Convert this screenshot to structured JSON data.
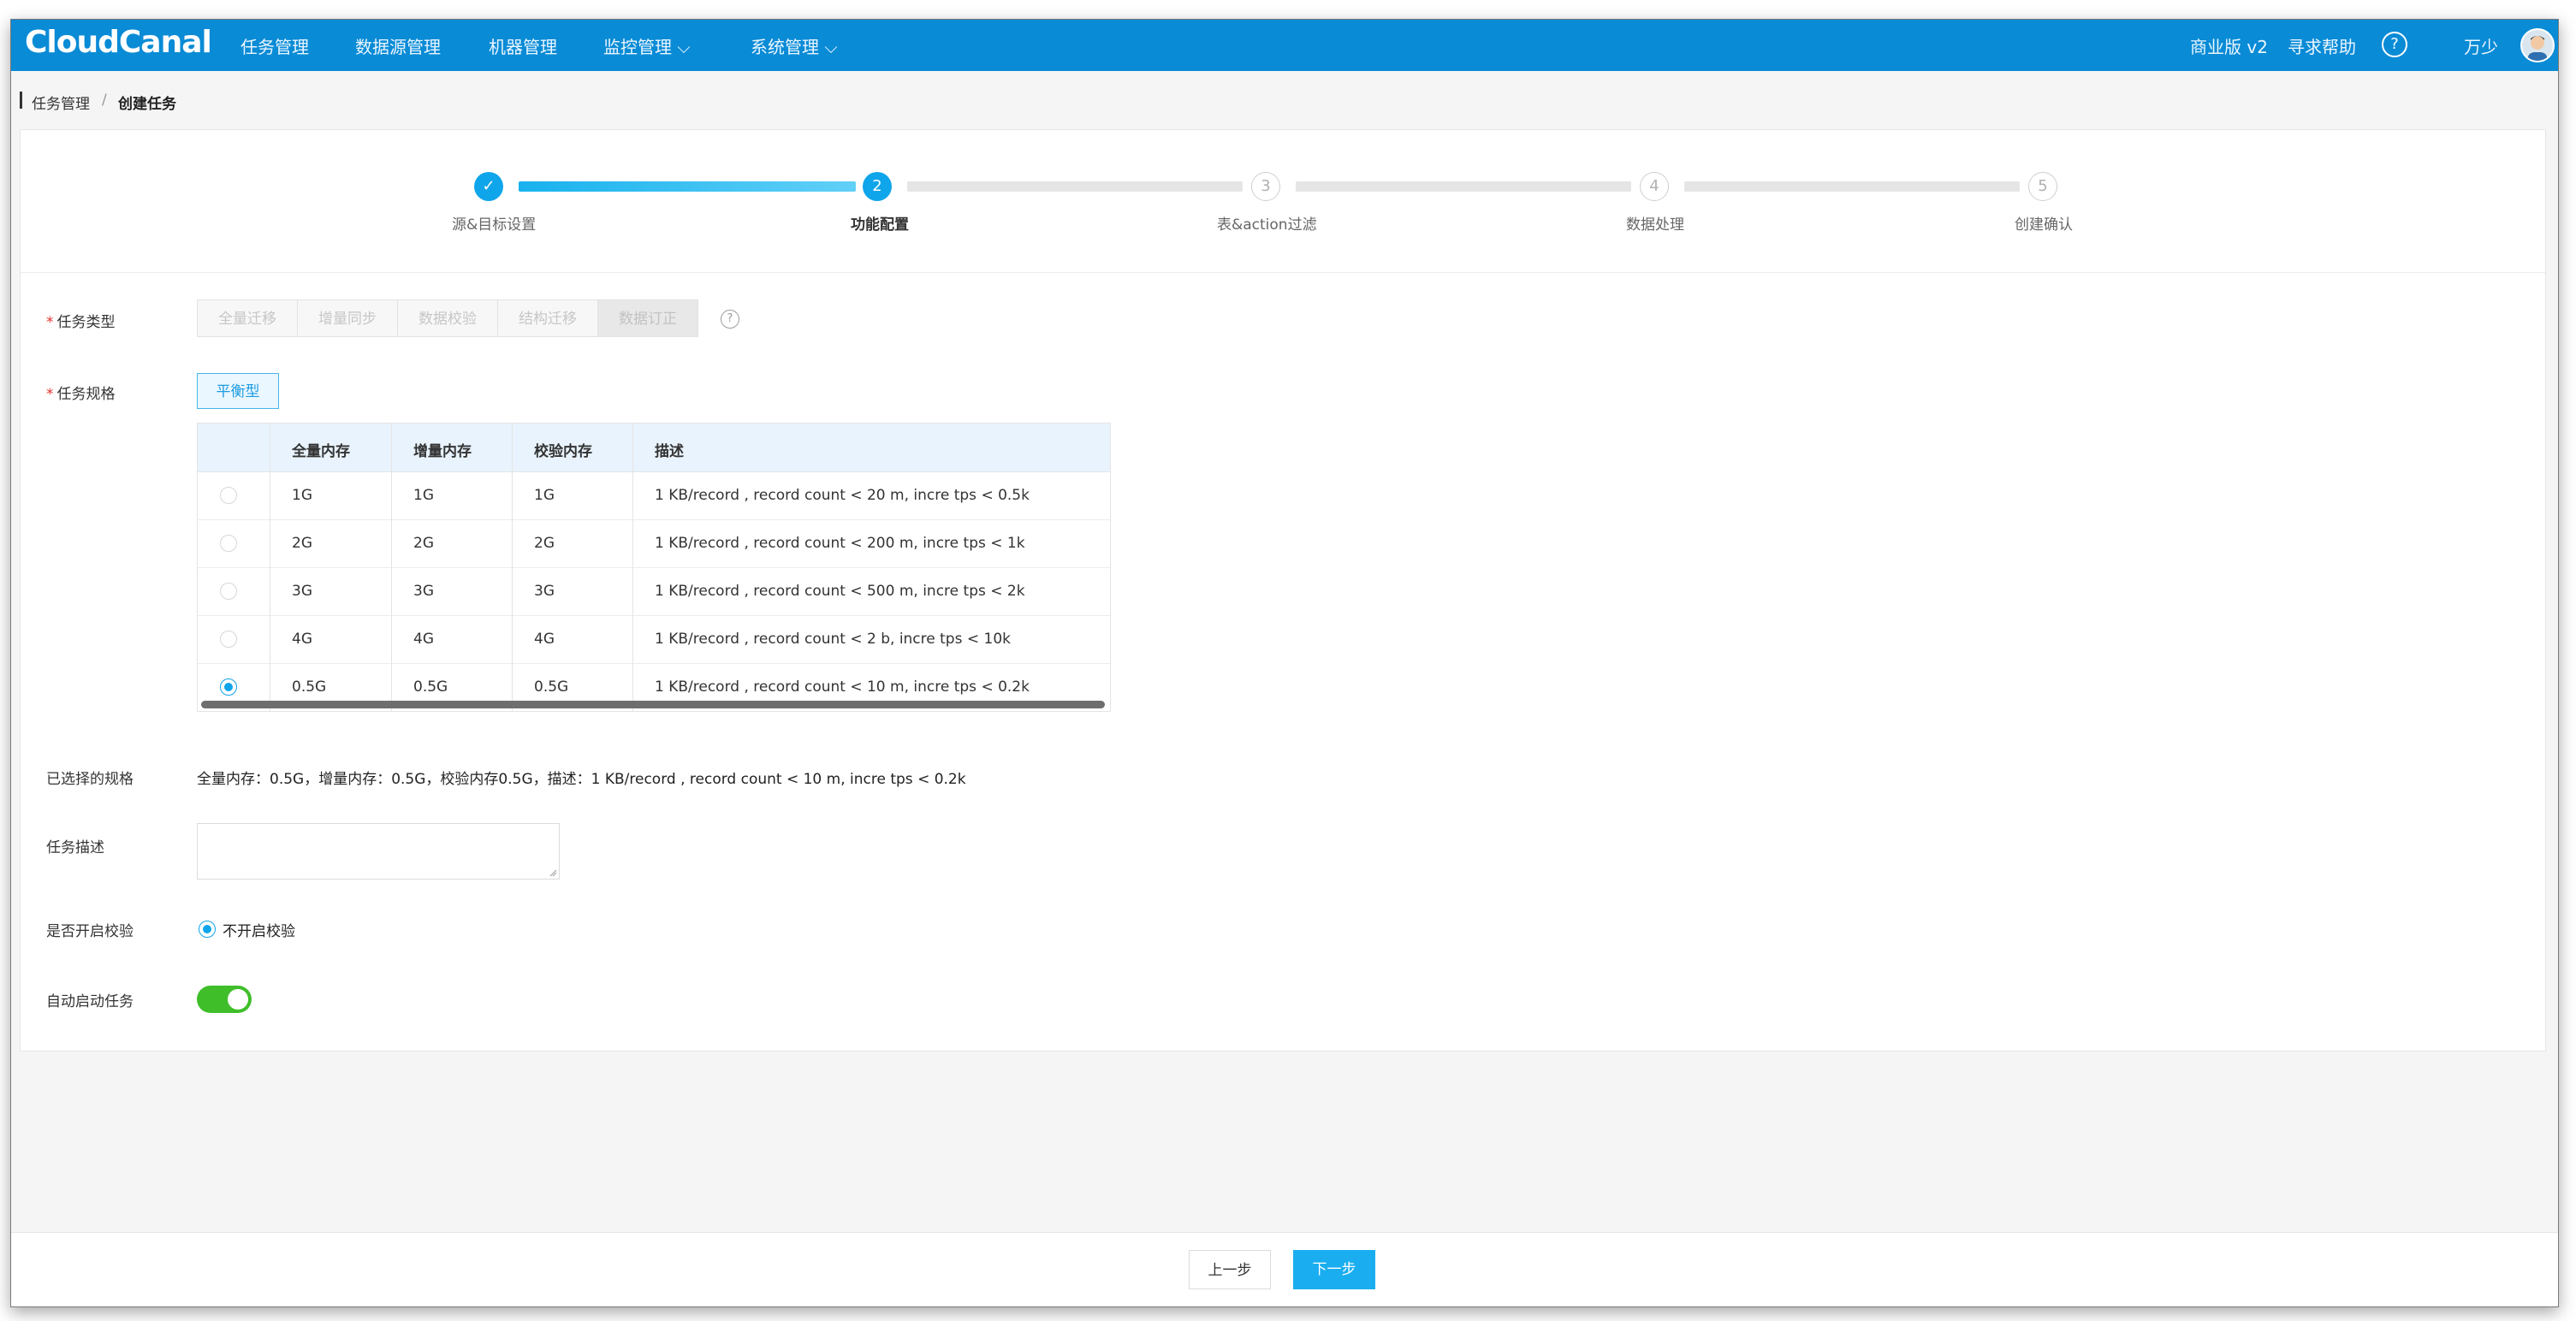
{
  "app": {
    "logo": "CloudCanal"
  },
  "nav": {
    "items": [
      "任务管理",
      "数据源管理",
      "机器管理",
      "监控管理 ⌵",
      "系统管理 ⌵"
    ],
    "edition": "商业版 v2",
    "help": "寻求帮助",
    "help_icon": "?",
    "user": "万少"
  },
  "breadcrumb": {
    "parent": "任务管理",
    "separator": "/",
    "current": "创建任务"
  },
  "steps": [
    {
      "index": "✓",
      "title": "源&目标设置",
      "state": "done"
    },
    {
      "index": "2",
      "title": "功能配置",
      "state": "active"
    },
    {
      "index": "3",
      "title": "表&action过滤",
      "state": "wait"
    },
    {
      "index": "4",
      "title": "数据处理",
      "state": "wait"
    },
    {
      "index": "5",
      "title": "创建确认",
      "state": "wait"
    }
  ],
  "form": {
    "task_type_label": "任务类型",
    "task_types": [
      "全量迁移",
      "增量同步",
      "数据校验",
      "结构迁移",
      "数据订正"
    ],
    "task_spec_label": "任务规格",
    "spec_option": "平衡型",
    "table": {
      "headers": [
        "全量内存",
        "增量内存",
        "校验内存",
        "描述"
      ],
      "rows": [
        {
          "full": "1G",
          "incr": "1G",
          "check": "1G",
          "desc": "1 KB/record , record count < 20 m, incre tps < 0.5k",
          "selected": false
        },
        {
          "full": "2G",
          "incr": "2G",
          "check": "2G",
          "desc": "1 KB/record , record count < 200 m, incre tps < 1k",
          "selected": false
        },
        {
          "full": "3G",
          "incr": "3G",
          "check": "3G",
          "desc": "1 KB/record , record count < 500 m, incre tps < 2k",
          "selected": false
        },
        {
          "full": "4G",
          "incr": "4G",
          "check": "4G",
          "desc": "1 KB/record , record count < 2 b, incre tps < 10k",
          "selected": false
        },
        {
          "full": "0.5G",
          "incr": "0.5G",
          "check": "0.5G",
          "desc": "1 KB/record , record count < 10 m, incre tps < 0.2k",
          "selected": true
        }
      ]
    },
    "selected_spec_label": "已选择的规格",
    "selected_spec_value": "全量内存：0.5G，增量内存：0.5G，校验内存0.5G，描述：1 KB/record , record count < 10 m, incre tps < 0.2k",
    "task_desc_label": "任务描述",
    "task_desc_value": "",
    "check_label": "是否开启校验",
    "check_option": "不开启校验",
    "auto_start_label": "自动启动任务",
    "auto_start_on": true
  },
  "footer": {
    "prev": "上一步",
    "next": "下一步"
  },
  "colors": {
    "nav_bg": "#0a8bd6",
    "accent": "#0fa5ea",
    "toggle_on": "#3fbe2a",
    "required": "#e8322e"
  }
}
